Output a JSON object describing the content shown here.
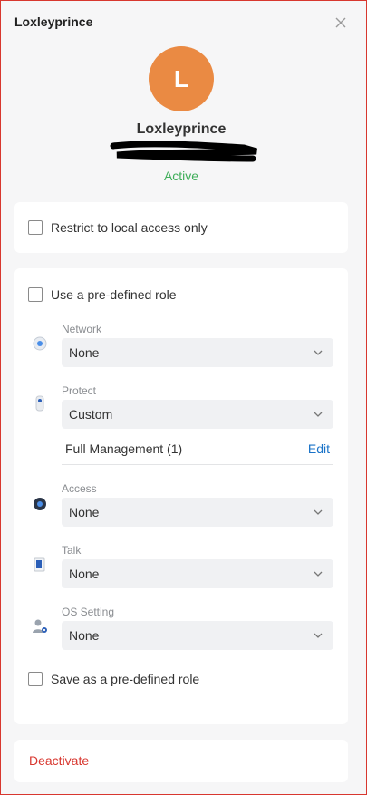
{
  "header": {
    "title": "Loxleyprince"
  },
  "profile": {
    "initial": "L",
    "name": "Loxleyprince",
    "status": "Active"
  },
  "local_access": {
    "label": "Restrict to local access only",
    "checked": false
  },
  "predefined_role": {
    "label": "Use a pre-defined role",
    "checked": false
  },
  "roles": [
    {
      "app": "Network",
      "value": "None",
      "icon": "network-device-icon"
    },
    {
      "app": "Protect",
      "value": "Custom",
      "icon": "camera-icon"
    },
    {
      "app": "Access",
      "value": "None",
      "icon": "access-reader-icon"
    },
    {
      "app": "Talk",
      "value": "None",
      "icon": "phone-icon"
    },
    {
      "app": "OS Setting",
      "value": "None",
      "icon": "user-settings-icon"
    }
  ],
  "protect_detail": {
    "text": "Full Management (1)",
    "edit_label": "Edit"
  },
  "save_role": {
    "label": "Save as a pre-defined role",
    "checked": false
  },
  "deactivate_label": "Deactivate",
  "colors": {
    "accent": "#1a73c8",
    "danger": "#d8372f",
    "active": "#3fae5a",
    "avatar": "#ea8a43"
  }
}
